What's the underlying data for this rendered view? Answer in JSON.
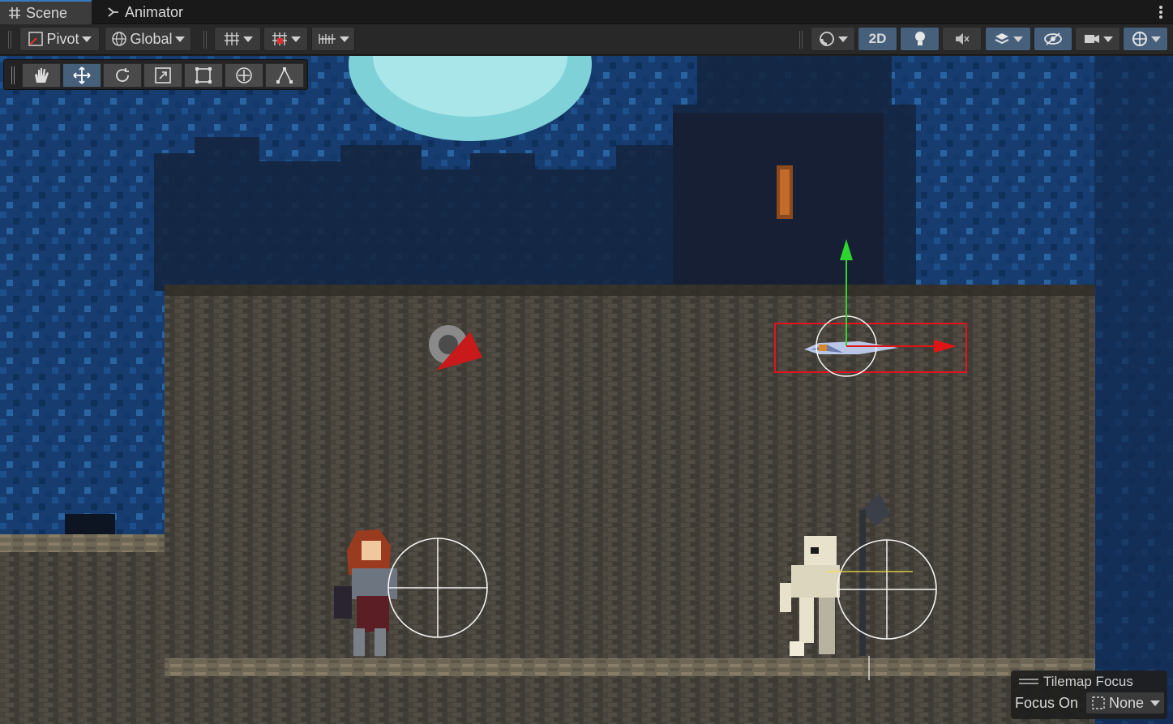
{
  "tabs": [
    {
      "label": "Scene",
      "icon": "grid-hash-icon",
      "active": true
    },
    {
      "label": "Animator",
      "icon": "animator-graph-icon",
      "active": false
    }
  ],
  "toolbar": {
    "pivot_label": "Pivot",
    "global_label": "Global",
    "mode_2d_label": "2D"
  },
  "tool_palette": {
    "tools": [
      "hand-tool",
      "move-tool",
      "rotate-tool",
      "scale-tool",
      "rect-tool",
      "transform-tool",
      "custom-editor-tool"
    ],
    "selected": "move-tool"
  },
  "tilemap_focus": {
    "title": "Tilemap Focus",
    "label": "Focus On",
    "value": "None"
  },
  "colors": {
    "accent_blue": "#46607c",
    "selection_red": "#e0141e",
    "gizmo_green": "#2ed52e",
    "gizmo_red": "#e01414",
    "sky": "#163a6b",
    "wall": "#4a4539"
  }
}
